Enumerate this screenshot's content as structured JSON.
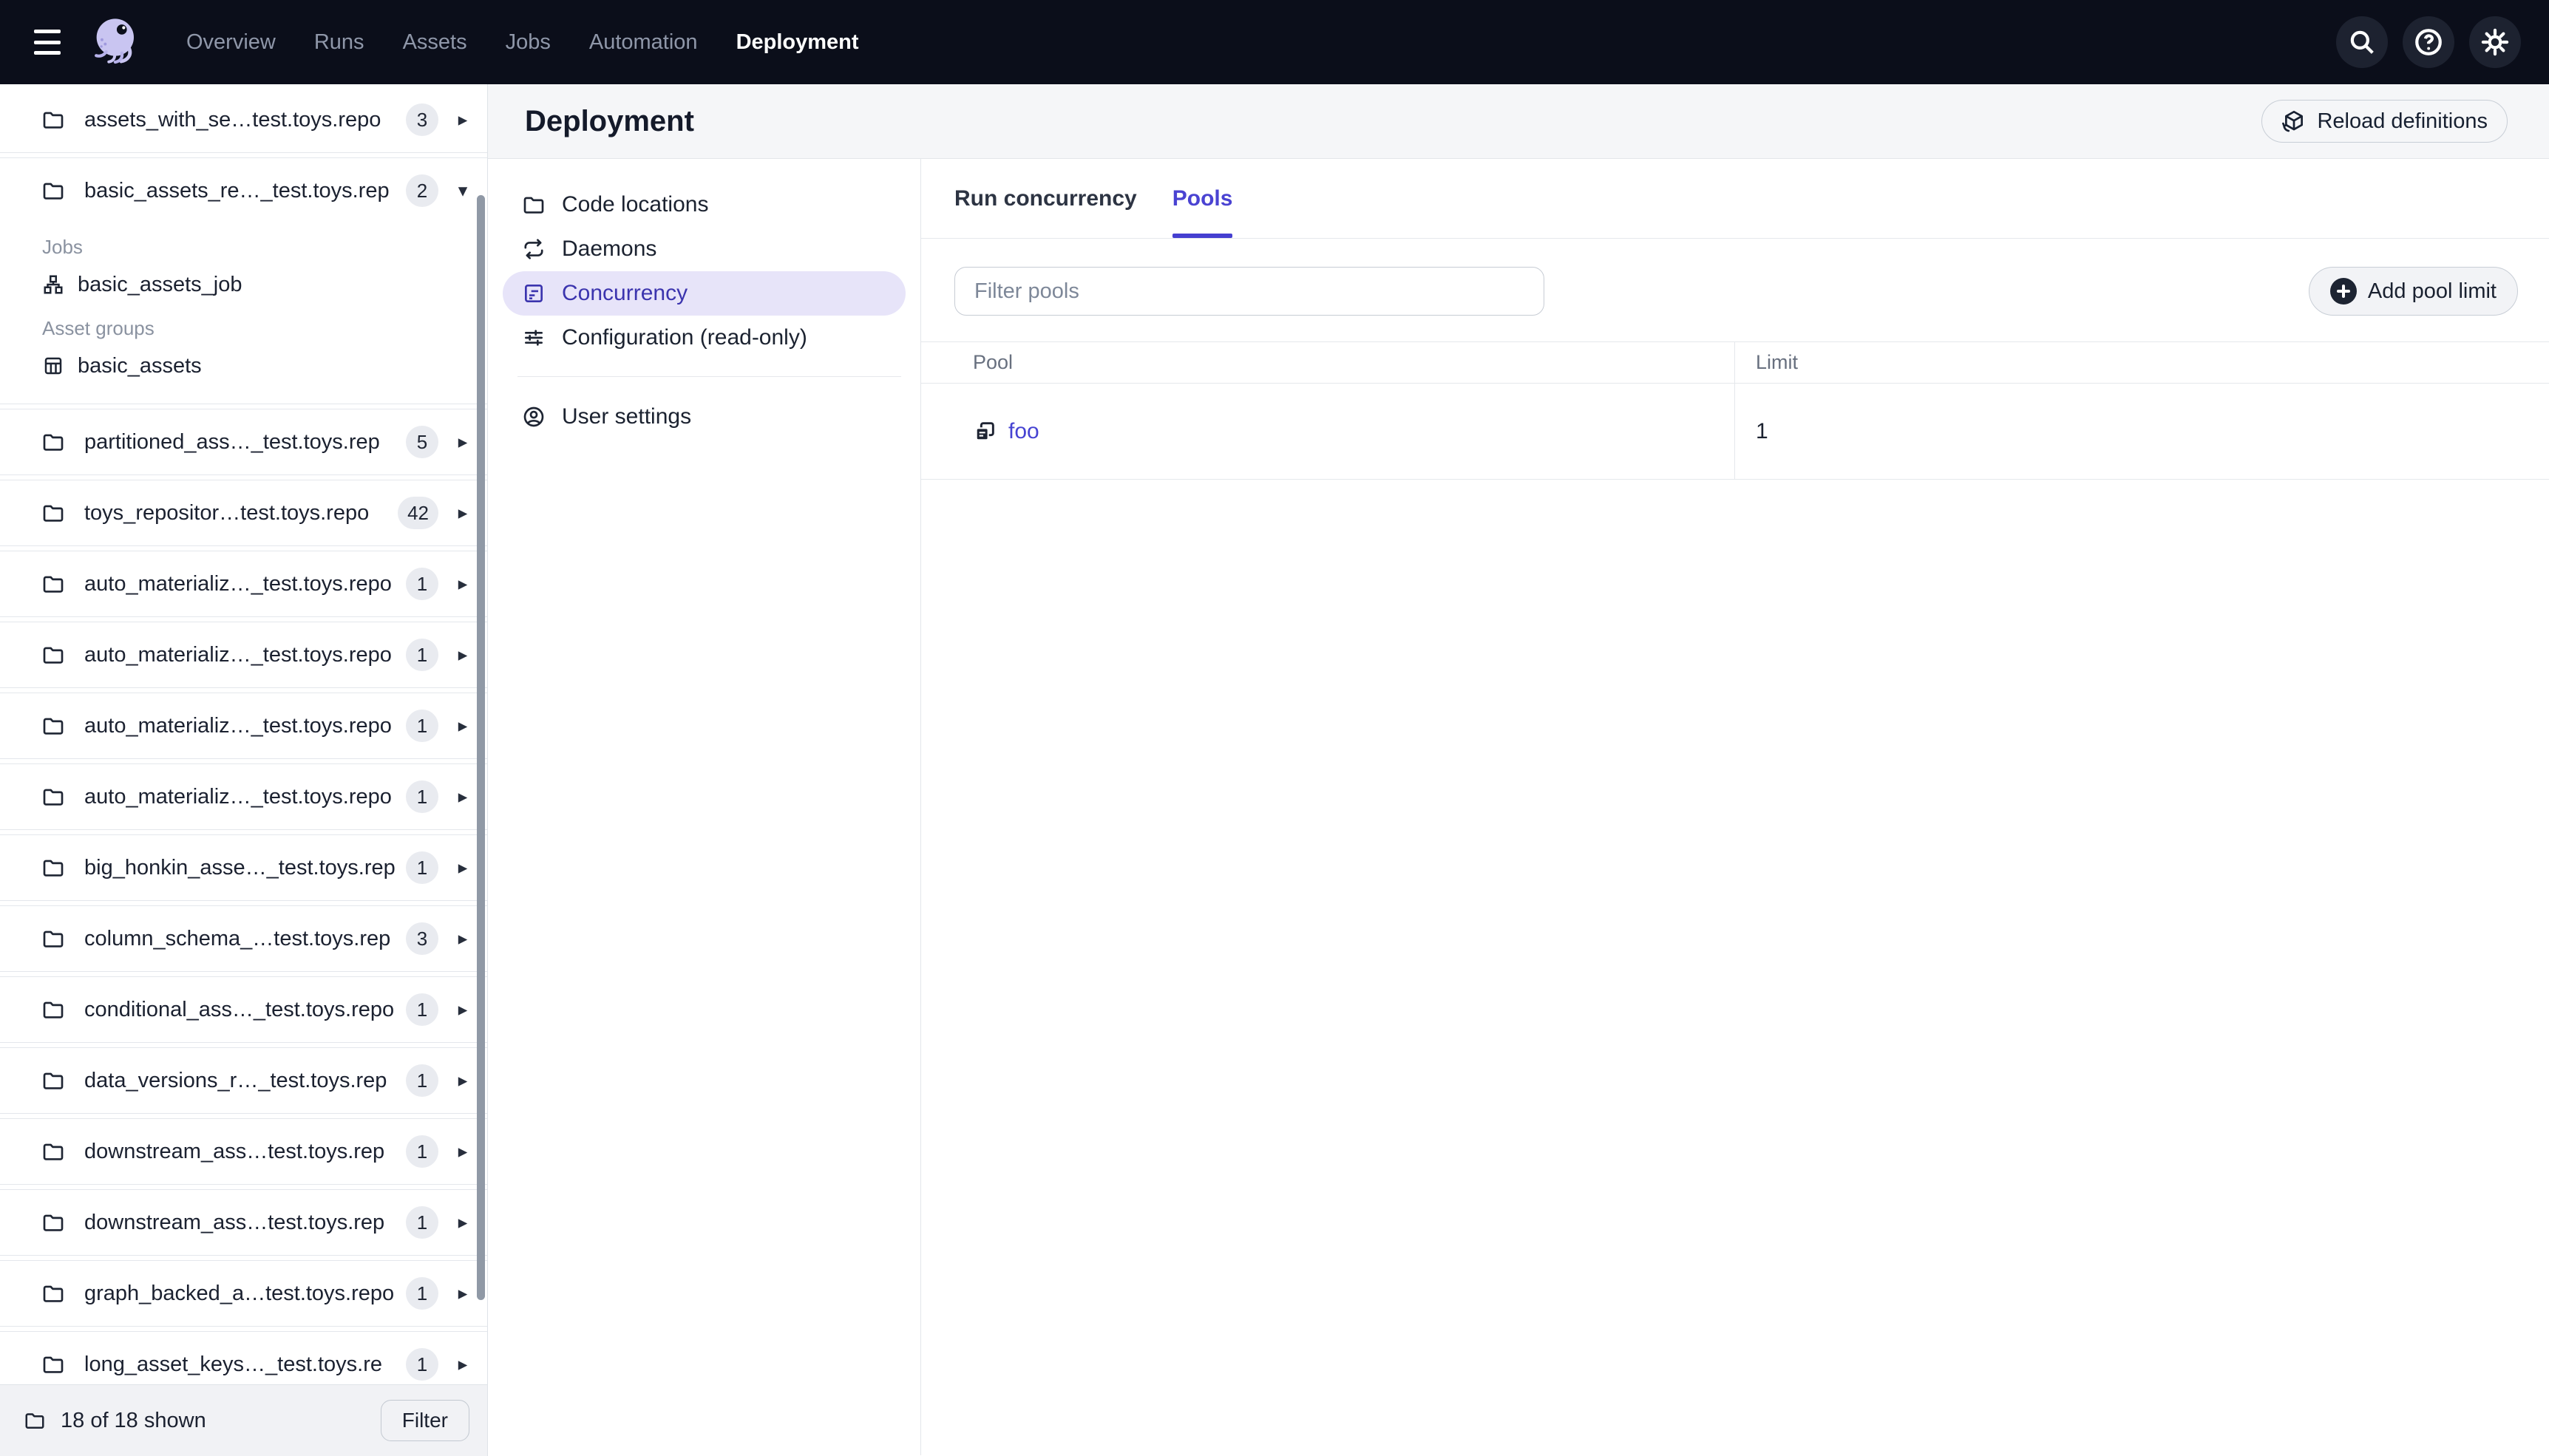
{
  "topnav": {
    "items": [
      {
        "label": "Overview"
      },
      {
        "label": "Runs"
      },
      {
        "label": "Assets"
      },
      {
        "label": "Jobs"
      },
      {
        "label": "Automation"
      },
      {
        "label": "Deployment",
        "active": true
      }
    ],
    "icons": [
      "search-icon",
      "help-icon",
      "settings-icon"
    ]
  },
  "sidebar": {
    "sections": [
      {
        "name": "assets_with_se…test.toys.repo",
        "badge": "3"
      },
      {
        "name": "basic_assets_re…_test.toys.rep",
        "badge": "2",
        "expanded": true,
        "jobs_header": "Jobs",
        "job": "basic_assets_job",
        "asset_groups_header": "Asset groups",
        "asset_group": "basic_assets"
      },
      {
        "name": "partitioned_ass…_test.toys.rep",
        "badge": "5"
      },
      {
        "name": "toys_repositor…test.toys.repo",
        "badge": "42"
      },
      {
        "name": "auto_materializ…_test.toys.repo",
        "badge": "1"
      },
      {
        "name": "auto_materializ…_test.toys.repo",
        "badge": "1"
      },
      {
        "name": "auto_materializ…_test.toys.repo",
        "badge": "1"
      },
      {
        "name": "auto_materializ…_test.toys.repo",
        "badge": "1"
      },
      {
        "name": "big_honkin_asse…_test.toys.rep",
        "badge": "1"
      },
      {
        "name": "column_schema_…test.toys.rep",
        "badge": "3"
      },
      {
        "name": "conditional_ass…_test.toys.repo",
        "badge": "1"
      },
      {
        "name": "data_versions_r…_test.toys.rep",
        "badge": "1"
      },
      {
        "name": "downstream_ass…test.toys.rep",
        "badge": "1"
      },
      {
        "name": "downstream_ass…test.toys.rep",
        "badge": "1"
      },
      {
        "name": "graph_backed_a…test.toys.repo",
        "badge": "1"
      },
      {
        "name": "long_asset_keys…_test.toys.re",
        "badge": "1"
      }
    ],
    "footer": {
      "count": "18 of 18 shown",
      "filter_button": "Filter"
    }
  },
  "deployment": {
    "title": "Deployment",
    "reload_button": "Reload definitions",
    "nav": [
      {
        "label": "Code locations"
      },
      {
        "label": "Daemons"
      },
      {
        "label": "Concurrency",
        "selected": true
      },
      {
        "label": "Configuration (read-only)"
      },
      {
        "label": "User settings"
      }
    ],
    "tabs": [
      {
        "label": "Run concurrency"
      },
      {
        "label": "Pools",
        "active": true
      }
    ],
    "pools": {
      "filter_placeholder": "Filter pools",
      "add_button": "Add pool limit",
      "table": {
        "columns": [
          "Pool",
          "Limit"
        ],
        "rows": [
          {
            "pool": "foo",
            "limit": "1"
          }
        ]
      }
    }
  },
  "colors": {
    "nav_bg": "#0b0e1a",
    "accent": "#453fd0",
    "accent_soft": "#e7e4f9",
    "link": "#4643d2",
    "logo_lavender": "#c9c5f1"
  }
}
